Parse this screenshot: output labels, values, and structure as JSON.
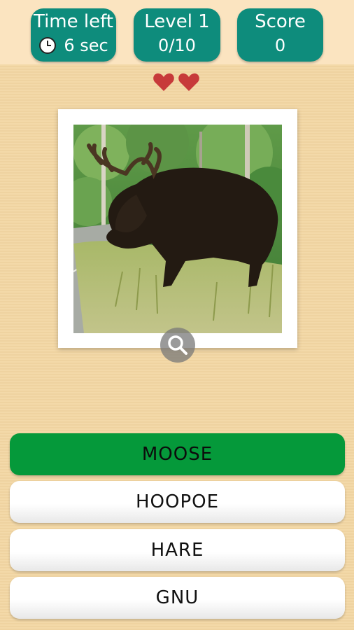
{
  "hud": {
    "time": {
      "label": "Time left",
      "value": "6 sec",
      "icon": "clock-icon"
    },
    "level": {
      "label": "Level 1",
      "value": "0/10"
    },
    "score": {
      "label": "Score",
      "value": "0"
    }
  },
  "lives": {
    "count": 2,
    "icon": "heart-icon",
    "color": "#c73a3a"
  },
  "question": {
    "image_subject": "moose",
    "zoom_icon": "magnifier-icon"
  },
  "answers": [
    {
      "label": "MOOSE",
      "state": "correct"
    },
    {
      "label": "HOOPOE",
      "state": "default"
    },
    {
      "label": "HARE",
      "state": "default"
    },
    {
      "label": "GNU",
      "state": "default"
    }
  ],
  "colors": {
    "hud": "#0e8c7c",
    "correct": "#05993a",
    "background": "#f3d9a9"
  }
}
